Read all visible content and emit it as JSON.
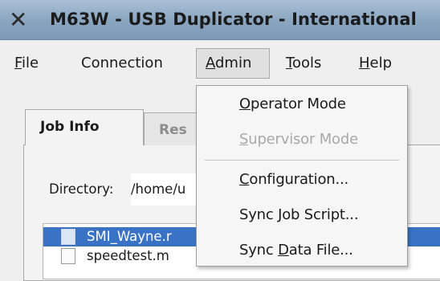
{
  "window": {
    "title": "M63W - USB Duplicator - International",
    "icon": "x-window-icon"
  },
  "menubar": {
    "items": [
      {
        "pre": "",
        "mnemonic": "F",
        "post": "ile"
      },
      {
        "pre": "Connection",
        "mnemonic": "",
        "post": ""
      },
      {
        "pre": "",
        "mnemonic": "A",
        "post": "dmin"
      },
      {
        "pre": "",
        "mnemonic": "T",
        "post": "ools"
      },
      {
        "pre": "",
        "mnemonic": "H",
        "post": "elp"
      }
    ],
    "active": "Admin"
  },
  "tabs": [
    {
      "label": "Job Info",
      "active": true
    },
    {
      "label": "Res",
      "active": false
    }
  ],
  "job": {
    "directory_label": "Directory:",
    "directory_value": "/home/u"
  },
  "files": [
    {
      "name": "SMI_Wayne.r",
      "selected": true
    },
    {
      "name": "speedtest.m",
      "selected": false
    }
  ],
  "admin_menu": {
    "items": [
      {
        "pre": "",
        "mnemonic": "O",
        "post": "perator Mode",
        "enabled": true
      },
      {
        "pre": "",
        "mnemonic": "S",
        "post": "upervisor Mode",
        "enabled": false
      },
      {
        "pre": "",
        "mnemonic": "C",
        "post": "onfiguration...",
        "enabled": true
      },
      {
        "pre": "Sync ",
        "mnemonic": "J",
        "post": "ob Script...",
        "enabled": true
      },
      {
        "pre": "Sync ",
        "mnemonic": "D",
        "post": "ata File...",
        "enabled": true
      }
    ]
  },
  "colors": {
    "titlebar": "#8aa5c0",
    "selection": "#3a73c4",
    "disabled_text": "#a8a8a8"
  }
}
